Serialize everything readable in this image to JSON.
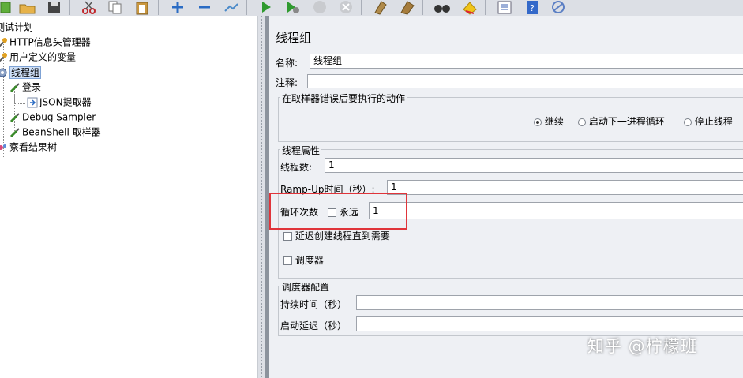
{
  "toolbar": {
    "icons": [
      "new-icon",
      "open-icon",
      "save-icon",
      "cut-icon",
      "copy-icon",
      "paste-icon",
      "expand-icon",
      "collapse-icon",
      "toggle-icon",
      "start-icon",
      "start-no-pause-icon",
      "stop-icon",
      "shutdown-icon",
      "clear-icon",
      "clear-all-icon",
      "search-icon",
      "reset-search-icon",
      "function-helper-icon",
      "help-icon",
      "remote-icon"
    ]
  },
  "tree": {
    "root": "测试计划",
    "items": [
      {
        "label": "HTTP信息头管理器",
        "icon": "wrench-icon"
      },
      {
        "label": "用户定义的变量",
        "icon": "wrench-icon"
      },
      {
        "label": "线程组",
        "icon": "gear-icon"
      },
      {
        "label": "登录",
        "icon": "pipette-icon"
      },
      {
        "label": "JSON提取器",
        "icon": "arrow-icon"
      },
      {
        "label": "Debug Sampler",
        "icon": "pipette-icon"
      },
      {
        "label": "BeanShell 取样器",
        "icon": "pipette-icon"
      },
      {
        "label": "察看结果树",
        "icon": "tree-result-icon"
      }
    ]
  },
  "panel": {
    "title": "线程组",
    "name_label": "名称:",
    "name_value": "线程组",
    "comment_label": "注释:",
    "comment_value": "",
    "error_group": {
      "title": "在取样器错误后要执行的动作",
      "options": [
        "继续",
        "启动下一进程循环",
        "停止线程"
      ],
      "selected": "继续"
    },
    "thread_props": {
      "title": "线程属性",
      "threads_label": "线程数:",
      "threads_value": "1",
      "rampup_label": "Ramp-Up时间（秒）:",
      "rampup_value": "1",
      "loop_label": "循环次数",
      "forever_label": "永远",
      "forever_checked": false,
      "loop_value": "1",
      "delay_label": "延迟创建线程直到需要",
      "scheduler_label": "调度器"
    },
    "scheduler_group": {
      "title": "调度器配置",
      "duration_label": "持续时间（秒）",
      "duration_value": "",
      "startup_delay_label": "启动延迟（秒）",
      "startup_delay_value": ""
    }
  },
  "watermark": "知乎 @柠檬班",
  "colors": {
    "highlight": "#e0343a",
    "selection": "#cfe0f7",
    "panel_bg": "#eef0f4"
  }
}
